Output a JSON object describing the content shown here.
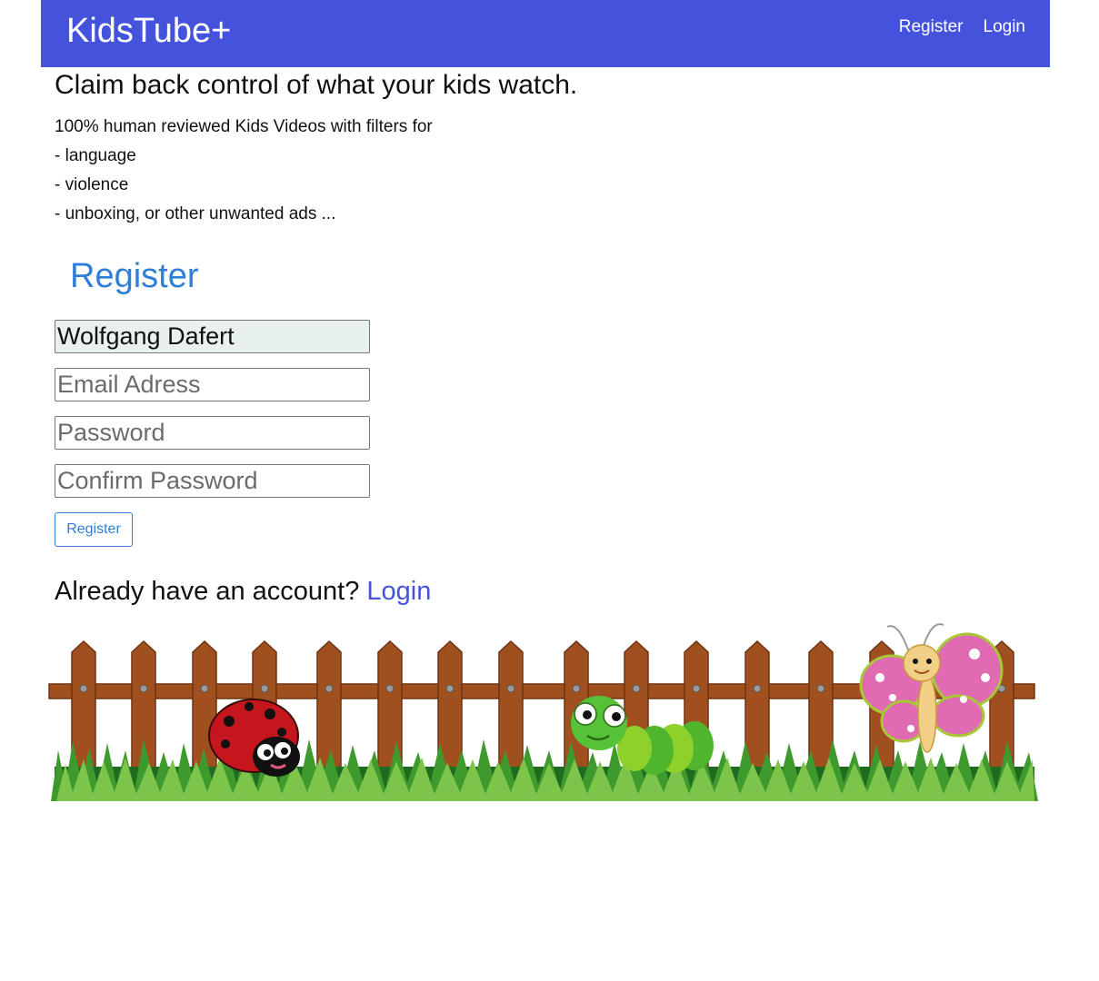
{
  "navbar": {
    "brand": "KidsTube+",
    "links": [
      "Register",
      "Login"
    ],
    "color": "#4553dc"
  },
  "hero": {
    "headline": "Claim back control of what your kids watch.",
    "features": [
      "100% human reviewed Kids Videos with filters for",
      "- language",
      "- violence",
      "- unboxing, or other unwanted ads ..."
    ]
  },
  "register_form": {
    "title": "Register",
    "name_value": "Wolfgang Dafert",
    "email_placeholder": "Email Adress",
    "password_placeholder": "Password",
    "confirm_placeholder": "Confirm Password",
    "submit_label": "Register",
    "accent": "#2f7fd9"
  },
  "login_prompt": {
    "text": "Already have an account?",
    "link": "Login"
  },
  "illustration": {
    "items": [
      "fence",
      "grass",
      "ladybug",
      "caterpillar",
      "butterfly"
    ]
  }
}
